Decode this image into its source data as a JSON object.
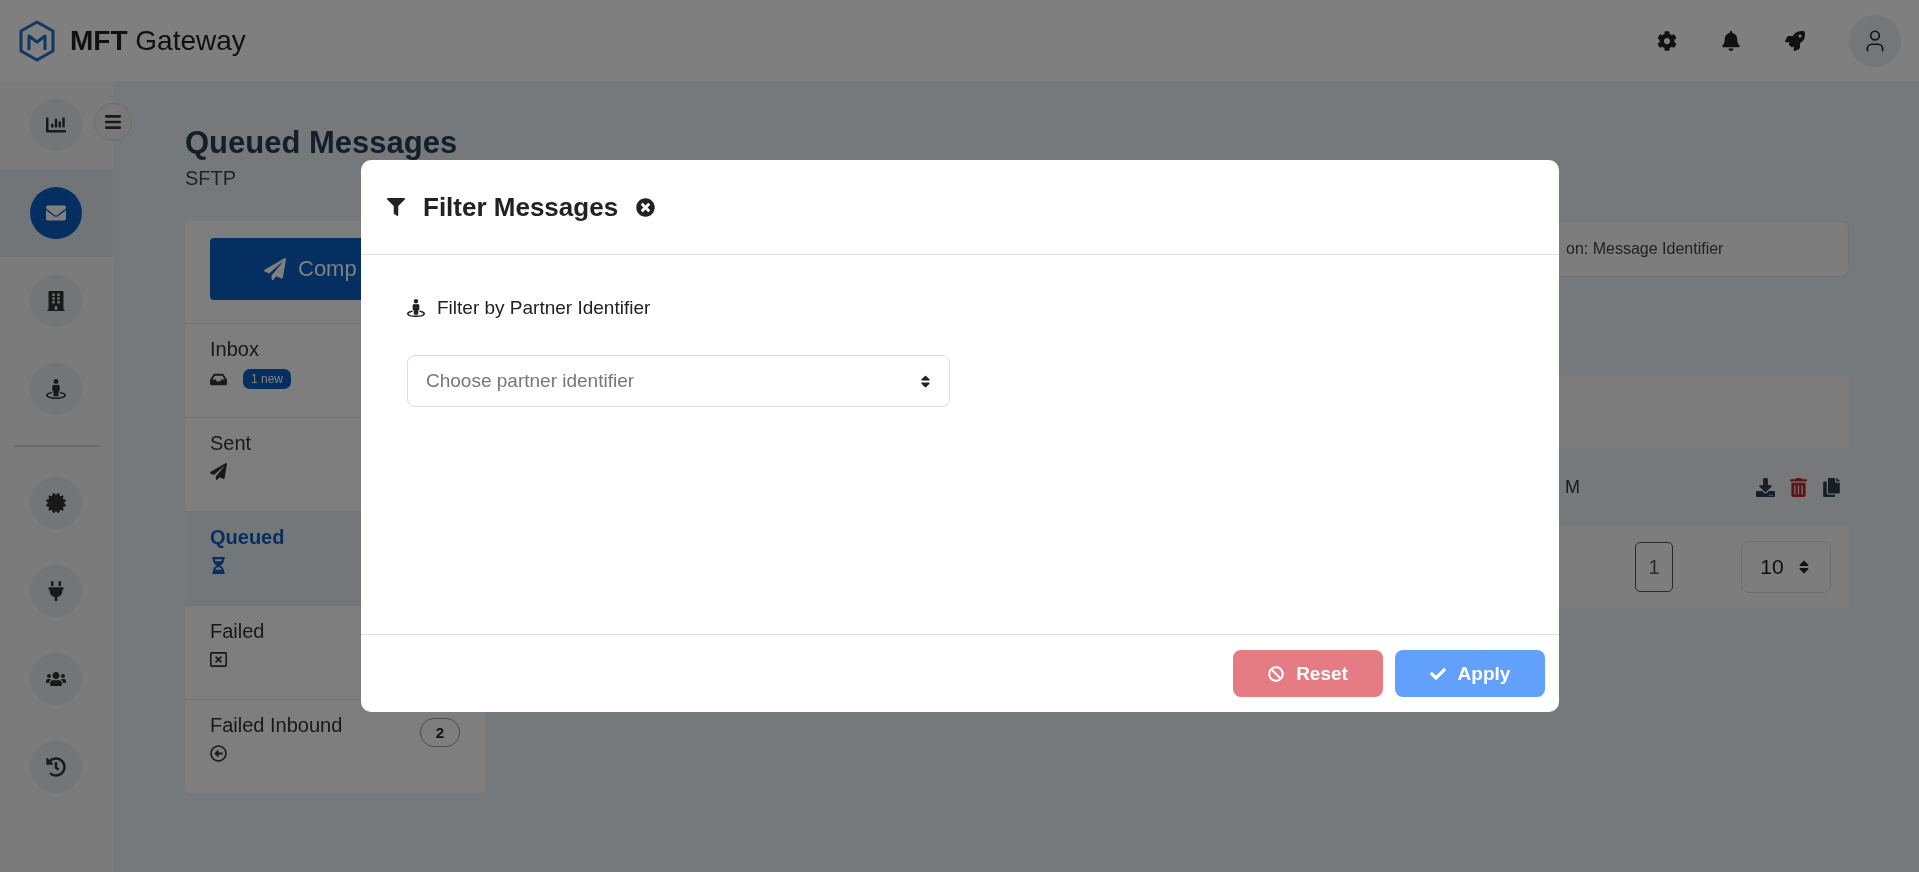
{
  "app": {
    "title": "**MFT** Gateway"
  },
  "sidebar": {
    "primary_items": [
      {
        "selected": false
      },
      {
        "selected": true
      },
      {
        "selected": false
      },
      {
        "selected": false
      }
    ],
    "secondary_items": [
      {
        "selected": false
      },
      {
        "selected": false
      },
      {
        "selected": false
      },
      {
        "selected": false
      }
    ]
  },
  "page": {
    "title": "Queued Messages",
    "subtitle": "SFTP",
    "compose_button": "Comp",
    "folders": [
      {
        "label": "Inbox",
        "badge": "1 new",
        "selected": false
      },
      {
        "label": "Sent",
        "selected": false
      },
      {
        "label": "Queued",
        "selected": true
      },
      {
        "label": "Failed",
        "selected": false
      },
      {
        "label": "Failed Inbound",
        "count": "2",
        "selected": false
      }
    ],
    "search_text": "on: Message Identifier",
    "table": {
      "rows": [
        {
          "column_1": "M"
        }
      ]
    },
    "pagination": {
      "page": "1",
      "page_size": "10"
    }
  },
  "modal": {
    "title": "Filter Messages",
    "filter_label": "Filter by Partner Identifier",
    "select": {
      "placeholder": "Choose partner identifier"
    },
    "buttons": [
      {
        "kind": "reset",
        "label": "Reset"
      },
      {
        "kind": "apply",
        "label": "Apply"
      }
    ]
  }
}
